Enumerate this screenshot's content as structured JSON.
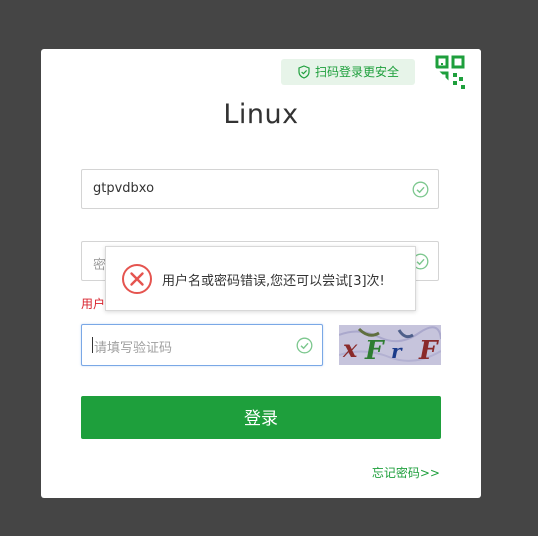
{
  "qr_tip": {
    "label": "扫码登录更安全"
  },
  "title": "Linux",
  "username": {
    "value": "gtpvdbxo"
  },
  "password": {
    "placeholder_partial": "密"
  },
  "error_partial": "用户",
  "captcha": {
    "placeholder": "请填写验证码",
    "image_text": "xFrF"
  },
  "login_button": "登录",
  "forgot_link": "忘记密码>>",
  "toast": {
    "message": "用户名或密码错误,您还可以尝试[3]次!"
  },
  "colors": {
    "accent": "#1e9f3c",
    "error": "#d9232d",
    "background": "#454545"
  },
  "icons": [
    "shield-icon",
    "qr-code-icon",
    "check-icon",
    "error-circle-icon"
  ]
}
